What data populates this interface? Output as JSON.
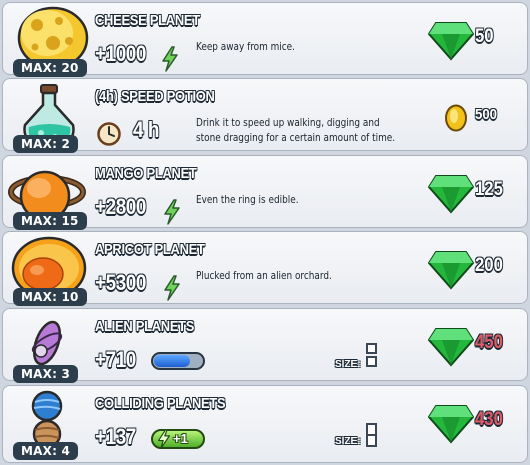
{
  "items": [
    {
      "name": "CHEESE PLANET",
      "max": "MAX: 20",
      "value": "+1000",
      "desc": "Keep away from mice.",
      "price": "50",
      "currency": "gem",
      "icon": "lightning-icon"
    },
    {
      "name": "(4h) SPEED POTION",
      "max": "MAX: 2",
      "value": "4 h",
      "desc": "Drink it to speed up walking, digging and stone dragging for a certain amount of time.",
      "price": "500",
      "currency": "coin",
      "icon": "clock-icon"
    },
    {
      "name": "MANGO PLANET",
      "max": "MAX: 15",
      "value": "+2800",
      "desc": "Even the ring is edible.",
      "price": "125",
      "currency": "gem",
      "icon": "lightning-icon"
    },
    {
      "name": "APRICOT PLANET",
      "max": "MAX: 10",
      "value": "+5300",
      "desc": "Plucked from an alien orchard.",
      "price": "200",
      "currency": "gem",
      "icon": "lightning-icon"
    },
    {
      "name": "ALIEN PLANETS",
      "max": "MAX: 3",
      "value": "+710",
      "desc": "",
      "price": "450",
      "currency": "gem",
      "icon": "energy-bar-icon",
      "size_label": "SIZE:"
    },
    {
      "name": "COLLIDING PLANETS",
      "max": "MAX: 4",
      "value": "+137",
      "desc": "",
      "price": "430",
      "currency": "gem",
      "icon": "energy-plus-icon",
      "badge": "+1",
      "size_label": "SIZE:"
    }
  ],
  "colors": {
    "gem": "#1fbf3a",
    "price_red": "#e15a67",
    "coin": "#f2c21a"
  }
}
